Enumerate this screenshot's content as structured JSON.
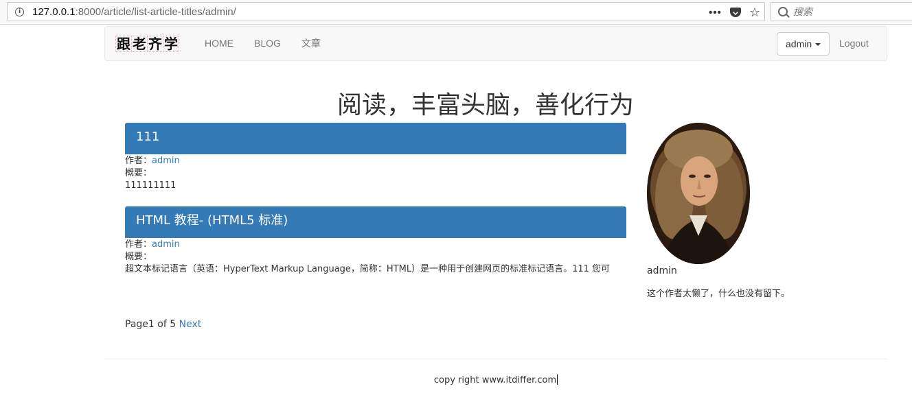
{
  "browser": {
    "url_host": "127.0.0.1",
    "url_path": ":8000/article/list-article-titles/admin/",
    "search_placeholder": "搜索"
  },
  "navbar": {
    "logo_chars": [
      "跟",
      "老",
      "齐",
      "学"
    ],
    "links": [
      "HOME",
      "BLOG",
      "文章"
    ],
    "user_button": "admin",
    "logout": "Logout"
  },
  "page": {
    "title": "阅读，丰富头脑，善化行为"
  },
  "articles": [
    {
      "title": "111",
      "author_label": "作者：",
      "author": "admin",
      "summary_label": "概要：",
      "summary": "111111111"
    },
    {
      "title": "HTML 教程- (HTML5 标准)",
      "author_label": "作者：",
      "author": "admin",
      "summary_label": "概要：",
      "summary": "超文本标记语言（英语：HyperText Markup Language，简称：HTML）是一种用于创建网页的标准标记语言。111 您可"
    }
  ],
  "pagination": {
    "page_prefix": "Page",
    "current": "1",
    "of_label": "of",
    "total": "5",
    "next": "Next"
  },
  "sidebar": {
    "name": "admin",
    "bio": "这个作者太懒了，什么也没有留下。"
  },
  "footer": {
    "text": "copy right www.itdiffer.com"
  }
}
